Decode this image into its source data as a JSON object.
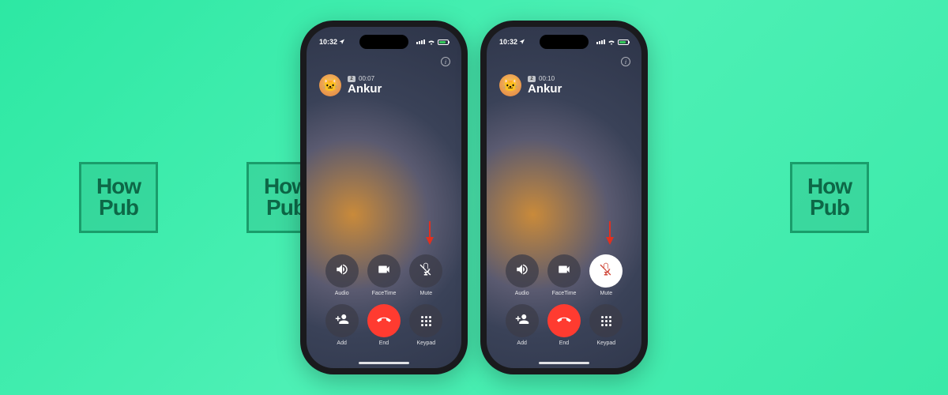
{
  "watermark": {
    "line1": "How",
    "line2": "Pub"
  },
  "phones": [
    {
      "status": {
        "time": "10:32",
        "location_icon": "location-arrow"
      },
      "call": {
        "duration": "00:07",
        "name": "Ankur",
        "sim": "2"
      },
      "muted": false,
      "buttons": {
        "audio": "Audio",
        "facetime": "FaceTime",
        "mute": "Mute",
        "add": "Add",
        "end": "End",
        "keypad": "Keypad"
      }
    },
    {
      "status": {
        "time": "10:32",
        "location_icon": "location-arrow"
      },
      "call": {
        "duration": "00:10",
        "name": "Ankur",
        "sim": "2"
      },
      "muted": true,
      "buttons": {
        "audio": "Audio",
        "facetime": "FaceTime",
        "mute": "Mute",
        "add": "Add",
        "end": "End",
        "keypad": "Keypad"
      }
    }
  ],
  "colors": {
    "accent_green": "#2de8a3",
    "end_red": "#ff3b30",
    "arrow_red": "#e03020"
  }
}
